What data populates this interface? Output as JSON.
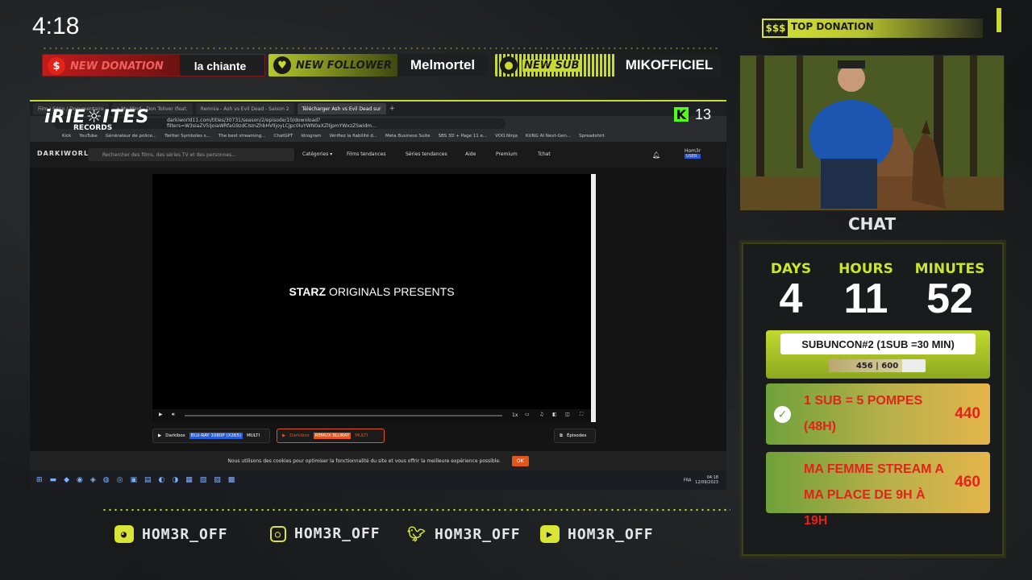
{
  "clock": "4:18",
  "alerts": {
    "donation": {
      "label": "NEW DONATION",
      "value": "la chiante"
    },
    "follower": {
      "label": "NEW FOLLOWER",
      "value": "Melmortel"
    },
    "sub": {
      "label": "NEW SUB",
      "value": "MIKOFFICIEL"
    }
  },
  "top_donation": {
    "label": "TOP DONATION"
  },
  "logo": {
    "line1": "iRIE☼ITES",
    "line2": "RECORDS"
  },
  "kick": {
    "viewers": "13"
  },
  "browser": {
    "tabs": [
      "Film / Série / Documentaire",
      "e My Mind - Don Toliver (feat.",
      "Remnia - Ash vs Evil Dead - Saison 2",
      "Télécharger Ash vs Evil Dead sur"
    ],
    "url": "darkiworld11.com/titles/30731/season/2/episode/10/download?filters=W3siaZV5IjoiaWRfaG9zdCIsInZhbHVlIjoyLCJpc0luYWN0aXZlIjpmYWxzZSwidm...",
    "bookmarks": [
      "Kick",
      "YouTube",
      "Générateur de police...",
      "Twitter Symboles s...",
      "The best streaming...",
      "ChatGPT",
      "Idrogram",
      "Vérifiez la fiabilité d...",
      "Meta Business Suite",
      "SBS 3D + Page 11 e...",
      "VOO.Ninja",
      "KUNG AI Next-Gen...",
      "Spreadshirt"
    ]
  },
  "site": {
    "logo": "DARKIWORLD",
    "search_placeholder": "Rechercher des films, des séries TV et des personnes...",
    "nav": [
      "Catégories ▾",
      "Films tendances",
      "Séries tendances",
      "Aide",
      "Premium",
      "Tchat"
    ],
    "user": "Hom3r",
    "role": "USER",
    "episodes_label": "Épisodes",
    "cookie_text": "Nous utilisons des cookies pour optimiser la fonctionnalité du site et vous offrir la meilleure expérience possible.",
    "cookie_ok": "OK"
  },
  "video": {
    "brand": "STARZ",
    "caption": "ORIGINALS PRESENTS",
    "speed": "1x"
  },
  "sources": [
    {
      "name": "Darkibox",
      "quality": "BLU-RAY 1080P (X265)",
      "lang": "MULTI"
    },
    {
      "name": "Darkibox",
      "quality": "REMUX BLURAY",
      "lang": "MULTI"
    }
  ],
  "taskbar": {
    "lang": "FRA",
    "time": "04:18",
    "date": "12/09/2023"
  },
  "chat_label": "CHAT",
  "timer": {
    "days_label": "DAYS",
    "days": "4",
    "hours_label": "HOURS",
    "hours": "11",
    "minutes_label": "MINUTES",
    "minutes": "52"
  },
  "subuncon": {
    "title": "SUBUNCON#2 (1SUB =30 MIN)",
    "progress_text": "456 | 600",
    "current": 456,
    "target": 600
  },
  "goals": [
    {
      "text": "1 SUB = 5 POMPES (48H)",
      "value": "440",
      "completed": true
    },
    {
      "text": "MA FEMME STREAM A MA PLACE DE 9H À 19H",
      "value": "460",
      "completed": false
    }
  ],
  "socials": [
    {
      "platform": "discord",
      "handle": "HOM3R_OFF"
    },
    {
      "platform": "instagram",
      "handle": "HOM3R_OFF"
    },
    {
      "platform": "twitter",
      "handle": "HOM3R_OFF"
    },
    {
      "platform": "youtube",
      "handle": "HOM3R_OFF"
    }
  ],
  "colors": {
    "accent": "#c9da32",
    "alert_red": "#e2231a",
    "kick_green": "#53fc18"
  }
}
